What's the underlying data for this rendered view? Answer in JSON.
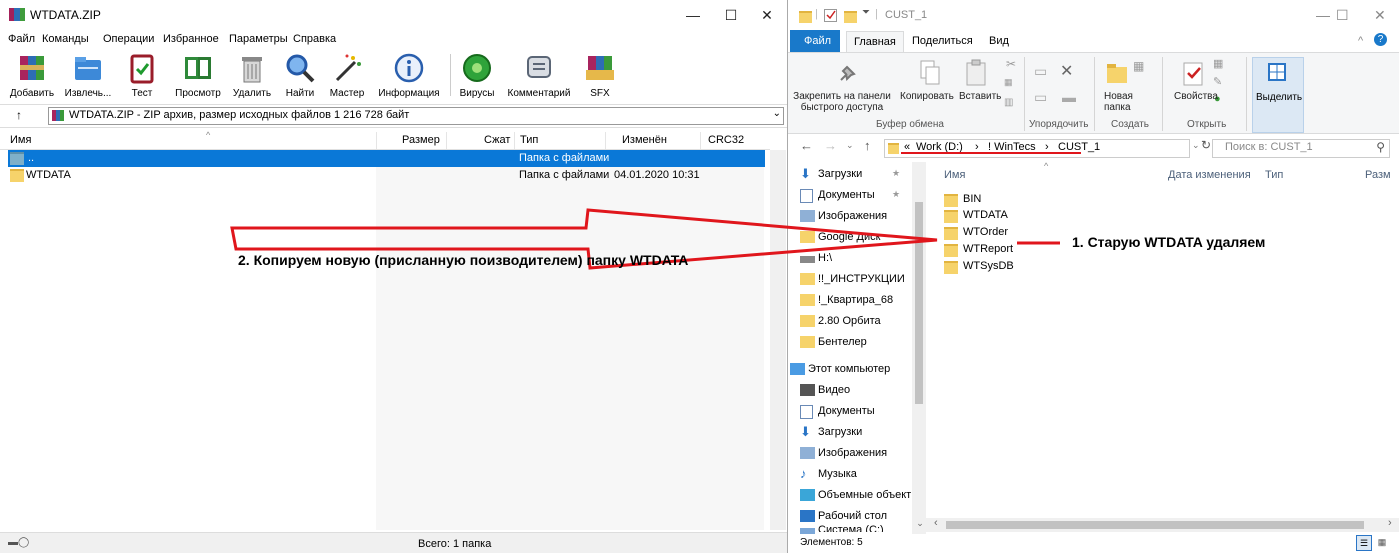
{
  "winrar": {
    "title": "WTDATA.ZIP",
    "menu": [
      "Файл",
      "Команды",
      "Операции",
      "Избранное",
      "Параметры",
      "Справка"
    ],
    "toolbar": [
      "Добавить",
      "Извлечь...",
      "Тест",
      "Просмотр",
      "Удалить",
      "Найти",
      "Мастер",
      "Информация",
      "Вирусы",
      "Комментарий",
      "SFX"
    ],
    "address": "WTDATA.ZIP - ZIP архив, размер исходных файлов 1 216 728 байт",
    "columns": [
      "Имя",
      "Размер",
      "Сжат",
      "Тип",
      "Изменён",
      "CRC32"
    ],
    "rows": [
      {
        "name": "..",
        "type": "Папка с файлами",
        "modified": ""
      },
      {
        "name": "WTDATA",
        "type": "Папка с файлами",
        "modified": "04.01.2020 10:31"
      }
    ],
    "status": "Всего: 1 папка"
  },
  "explorer": {
    "title": "CUST_1",
    "tabs": [
      "Файл",
      "Главная",
      "Поделиться",
      "Вид"
    ],
    "ribbon": {
      "pin": "Закрепить на панели быстрого доступа",
      "copy": "Копировать",
      "paste": "Вставить",
      "group_clipboard": "Буфер обмена",
      "group_organize": "Упорядочить",
      "new_folder": "Новая папка",
      "group_create": "Создать",
      "properties": "Свойства",
      "group_open": "Открыть",
      "select": "Выделить"
    },
    "breadcrumb": [
      "«",
      "Work (D:)",
      "›",
      "! WinTecs",
      "›",
      "CUST_1"
    ],
    "search_placeholder": "Поиск в: CUST_1",
    "nav": [
      "Загрузки",
      "Документы",
      "Изображения",
      "Google Диск",
      "H:\\",
      "!!_ИНСТРУКЦИИ",
      "!_Квартира_68",
      "2.80 Орбита",
      "Бентелер",
      "Этот компьютер",
      "Видео",
      "Документы",
      "Загрузки",
      "Изображения",
      "Музыка",
      "Объемные объекты",
      "Рабочий стол",
      "Система (C:)"
    ],
    "columns": [
      "Имя",
      "Дата изменения",
      "Тип",
      "Разм"
    ],
    "files": [
      "BIN",
      "WTDATA",
      "WTOrder",
      "WTReport",
      "WTSysDB"
    ],
    "status": "Элементов: 5"
  },
  "annotations": {
    "step1": "1. Старую WTDATA удаляем",
    "step2": "2. Копируем новую (присланную поизводителем) папку WTDATA"
  },
  "colors": {
    "selection": "#0a78d7",
    "arrow": "#e0161c",
    "ribbon_file_tab": "#1979ca",
    "folder": "#f6d36b"
  }
}
